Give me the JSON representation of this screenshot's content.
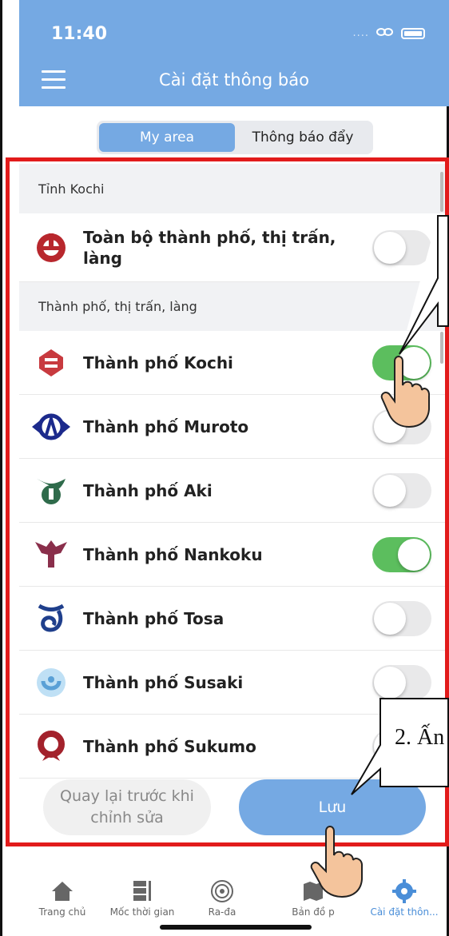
{
  "status_bar": {
    "time": "11:40",
    "dots": "....",
    "link_glyph": "∞"
  },
  "header": {
    "title": "Cài đặt thông báo"
  },
  "segmented": {
    "my_area": "My area",
    "push": "Thông báo đẩy",
    "active": "My area"
  },
  "prefecture_section": {
    "header": "Tỉnh Kochi",
    "row": {
      "label_line1": "Toàn bộ thành phố, thị trấn,",
      "label_line2": "làng",
      "enabled": false
    }
  },
  "cities_section": {
    "header": "Thành phố, thị trấn, làng",
    "items": [
      {
        "label": "Thành phố Kochi",
        "enabled": true,
        "logo": "kochi-city-emblem",
        "color": "#c83a3f"
      },
      {
        "label": "Thành phố Muroto",
        "enabled": false,
        "logo": "muroto-city-emblem",
        "color": "#1c2a8c"
      },
      {
        "label": "Thành phố Aki",
        "enabled": false,
        "logo": "aki-city-emblem",
        "color": "#2f6b4b"
      },
      {
        "label": "Thành phố Nankoku",
        "enabled": true,
        "logo": "nankoku-city-emblem",
        "color": "#8a2f4b"
      },
      {
        "label": "Thành phố Tosa",
        "enabled": false,
        "logo": "tosa-city-emblem",
        "color": "#1f3f8c"
      },
      {
        "label": "Thành phố Susaki",
        "enabled": false,
        "logo": "susaki-city-emblem",
        "color": "#5aa0d6"
      },
      {
        "label": "Thành phố Sukumo",
        "enabled": false,
        "logo": "sukumo-city-emblem",
        "color": "#a3222c"
      }
    ]
  },
  "buttons": {
    "revert_line1": "Quay lại trước khi",
    "revert_line2": "chỉnh sửa",
    "save": "Lưu"
  },
  "tabbar": {
    "items": [
      {
        "label": "Trang chủ",
        "icon": "home-icon",
        "active": false
      },
      {
        "label": "Mốc thời gian",
        "icon": "timeline-icon",
        "active": false
      },
      {
        "label": "Ra-đa",
        "icon": "radar-icon",
        "active": false
      },
      {
        "label": "Bản đồ p",
        "icon": "map-icon",
        "active": false
      },
      {
        "label": "Cài đặt thôn...",
        "icon": "settings-icon",
        "active": true
      }
    ]
  },
  "annotation": {
    "callout_text": "2. Ấn",
    "highlight_color": "#e21b1b"
  },
  "colors": {
    "accent": "#75a9e3",
    "toggle_on": "#5cbe5e",
    "toggle_off": "#e9e9ea"
  }
}
